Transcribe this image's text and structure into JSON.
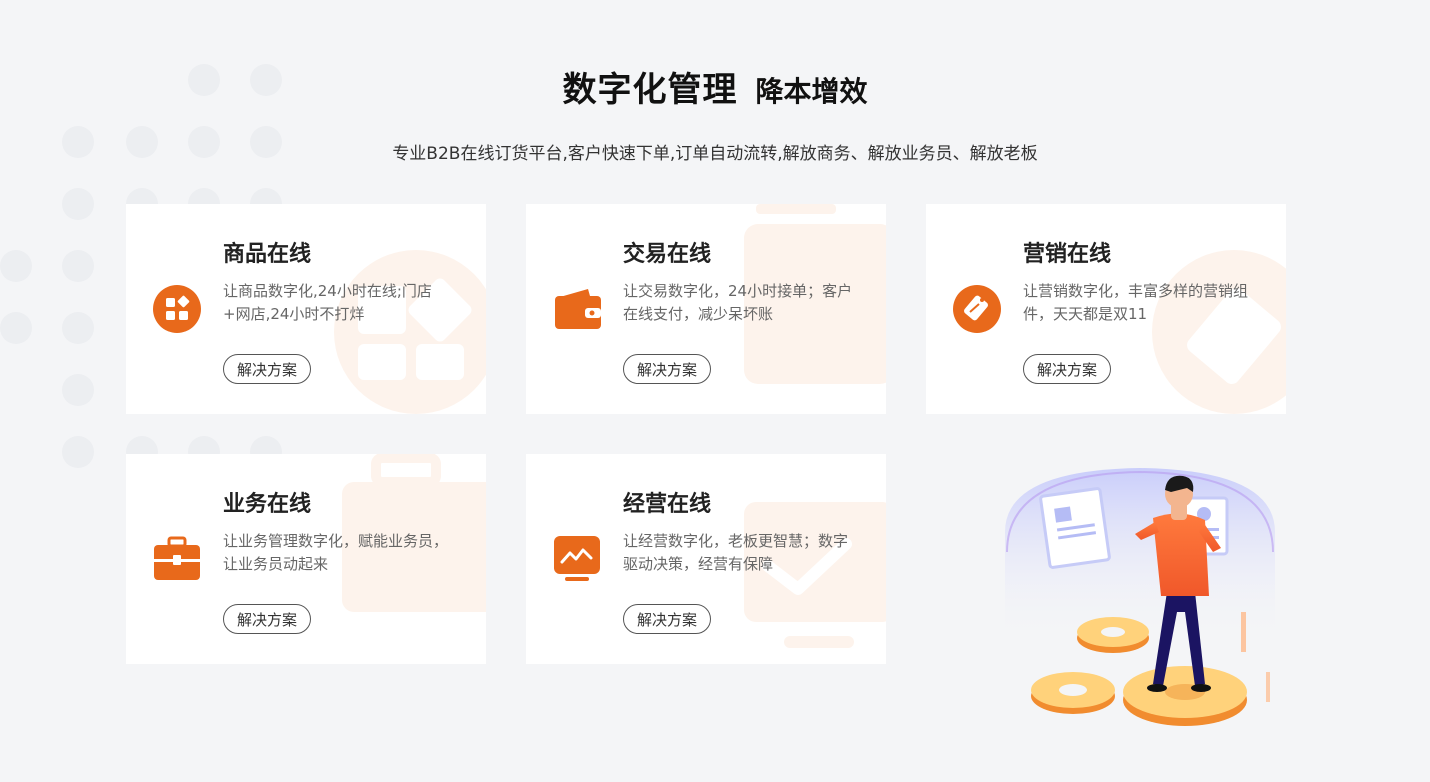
{
  "header": {
    "title": "数字化管理",
    "title_suffix": "降本增效",
    "subtitle": "专业B2B在线订货平台,客户快速下单,订单自动流转,解放商务、解放业务员、解放老板"
  },
  "colors": {
    "accent": "#e8691b",
    "accent_light": "#fdf3ec",
    "page_bg": "#f4f5f7"
  },
  "cards": [
    {
      "title": "商品在线",
      "desc": "让商品数字化,24小时在线;门店+网店,24小时不打烊",
      "button": "解决方案",
      "icon": "grid-apps-icon"
    },
    {
      "title": "交易在线",
      "desc": "让交易数字化，24小时接单；客户在线支付，减少呆坏账",
      "button": "解决方案",
      "icon": "wallet-icon"
    },
    {
      "title": "营销在线",
      "desc": "让营销数字化，丰富多样的营销组件，天天都是双11",
      "button": "解决方案",
      "icon": "price-tag-icon"
    },
    {
      "title": "业务在线",
      "desc": "让业务管理数字化，赋能业务员，让业务员动起来",
      "button": "解决方案",
      "icon": "briefcase-icon"
    },
    {
      "title": "经营在线",
      "desc": "让经营数字化，老板更智慧；数字驱动决策，经营有保障",
      "button": "解决方案",
      "icon": "trend-monitor-icon"
    }
  ]
}
